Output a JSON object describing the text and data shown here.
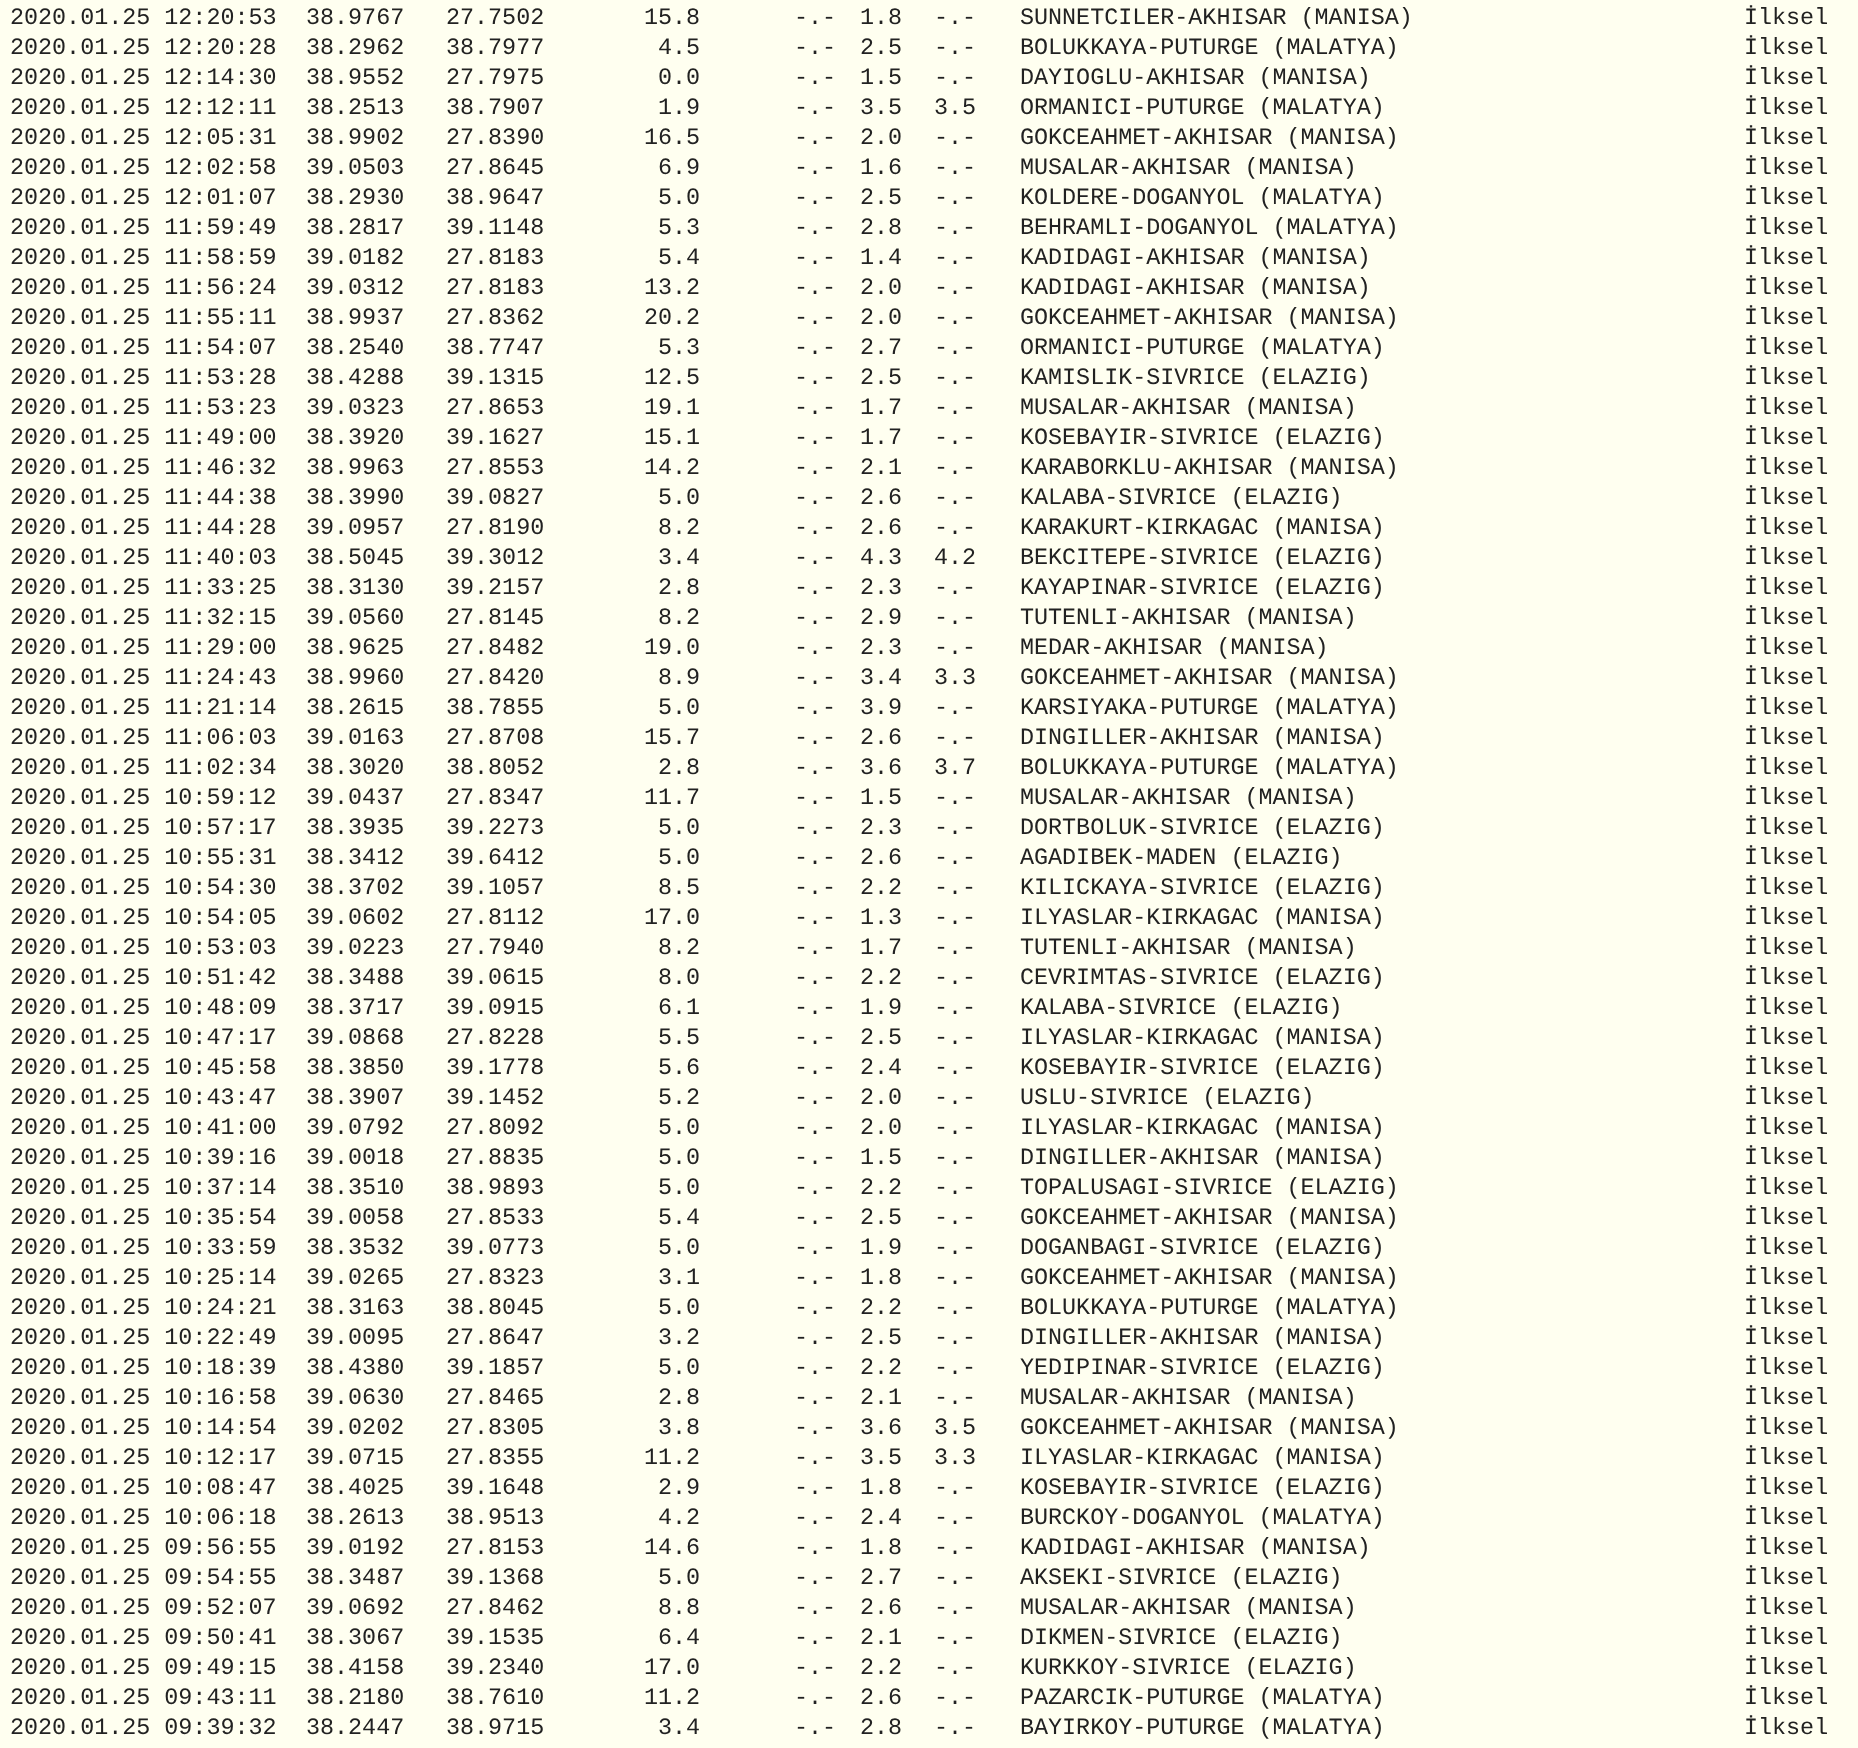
{
  "rows": [
    {
      "datetime": "2020.01.25 12:20:53",
      "latitude": "38.9767",
      "longitude": "27.7502",
      "depth": "15.8",
      "md": "-.-",
      "ml": "1.8",
      "mw": "-.-",
      "location": "SUNNETCILER-AKHISAR (MANISA)",
      "quality": "İlksel"
    },
    {
      "datetime": "2020.01.25 12:20:28",
      "latitude": "38.2962",
      "longitude": "38.7977",
      "depth": "4.5",
      "md": "-.-",
      "ml": "2.5",
      "mw": "-.-",
      "location": "BOLUKKAYA-PUTURGE (MALATYA)",
      "quality": "İlksel"
    },
    {
      "datetime": "2020.01.25 12:14:30",
      "latitude": "38.9552",
      "longitude": "27.7975",
      "depth": "0.0",
      "md": "-.-",
      "ml": "1.5",
      "mw": "-.-",
      "location": "DAYIOGLU-AKHISAR (MANISA)",
      "quality": "İlksel"
    },
    {
      "datetime": "2020.01.25 12:12:11",
      "latitude": "38.2513",
      "longitude": "38.7907",
      "depth": "1.9",
      "md": "-.-",
      "ml": "3.5",
      "mw": "3.5",
      "location": "ORMANICI-PUTURGE (MALATYA)",
      "quality": "İlksel"
    },
    {
      "datetime": "2020.01.25 12:05:31",
      "latitude": "38.9902",
      "longitude": "27.8390",
      "depth": "16.5",
      "md": "-.-",
      "ml": "2.0",
      "mw": "-.-",
      "location": "GOKCEAHMET-AKHISAR (MANISA)",
      "quality": "İlksel"
    },
    {
      "datetime": "2020.01.25 12:02:58",
      "latitude": "39.0503",
      "longitude": "27.8645",
      "depth": "6.9",
      "md": "-.-",
      "ml": "1.6",
      "mw": "-.-",
      "location": "MUSALAR-AKHISAR (MANISA)",
      "quality": "İlksel"
    },
    {
      "datetime": "2020.01.25 12:01:07",
      "latitude": "38.2930",
      "longitude": "38.9647",
      "depth": "5.0",
      "md": "-.-",
      "ml": "2.5",
      "mw": "-.-",
      "location": "KOLDERE-DOGANYOL (MALATYA)",
      "quality": "İlksel"
    },
    {
      "datetime": "2020.01.25 11:59:49",
      "latitude": "38.2817",
      "longitude": "39.1148",
      "depth": "5.3",
      "md": "-.-",
      "ml": "2.8",
      "mw": "-.-",
      "location": "BEHRAMLI-DOGANYOL (MALATYA)",
      "quality": "İlksel"
    },
    {
      "datetime": "2020.01.25 11:58:59",
      "latitude": "39.0182",
      "longitude": "27.8183",
      "depth": "5.4",
      "md": "-.-",
      "ml": "1.4",
      "mw": "-.-",
      "location": "KADIDAGI-AKHISAR (MANISA)",
      "quality": "İlksel"
    },
    {
      "datetime": "2020.01.25 11:56:24",
      "latitude": "39.0312",
      "longitude": "27.8183",
      "depth": "13.2",
      "md": "-.-",
      "ml": "2.0",
      "mw": "-.-",
      "location": "KADIDAGI-AKHISAR (MANISA)",
      "quality": "İlksel"
    },
    {
      "datetime": "2020.01.25 11:55:11",
      "latitude": "38.9937",
      "longitude": "27.8362",
      "depth": "20.2",
      "md": "-.-",
      "ml": "2.0",
      "mw": "-.-",
      "location": "GOKCEAHMET-AKHISAR (MANISA)",
      "quality": "İlksel"
    },
    {
      "datetime": "2020.01.25 11:54:07",
      "latitude": "38.2540",
      "longitude": "38.7747",
      "depth": "5.3",
      "md": "-.-",
      "ml": "2.7",
      "mw": "-.-",
      "location": "ORMANICI-PUTURGE (MALATYA)",
      "quality": "İlksel"
    },
    {
      "datetime": "2020.01.25 11:53:28",
      "latitude": "38.4288",
      "longitude": "39.1315",
      "depth": "12.5",
      "md": "-.-",
      "ml": "2.5",
      "mw": "-.-",
      "location": "KAMISLIK-SIVRICE (ELAZIG)",
      "quality": "İlksel"
    },
    {
      "datetime": "2020.01.25 11:53:23",
      "latitude": "39.0323",
      "longitude": "27.8653",
      "depth": "19.1",
      "md": "-.-",
      "ml": "1.7",
      "mw": "-.-",
      "location": "MUSALAR-AKHISAR (MANISA)",
      "quality": "İlksel"
    },
    {
      "datetime": "2020.01.25 11:49:00",
      "latitude": "38.3920",
      "longitude": "39.1627",
      "depth": "15.1",
      "md": "-.-",
      "ml": "1.7",
      "mw": "-.-",
      "location": "KOSEBAYIR-SIVRICE (ELAZIG)",
      "quality": "İlksel"
    },
    {
      "datetime": "2020.01.25 11:46:32",
      "latitude": "38.9963",
      "longitude": "27.8553",
      "depth": "14.2",
      "md": "-.-",
      "ml": "2.1",
      "mw": "-.-",
      "location": "KARABORKLU-AKHISAR (MANISA)",
      "quality": "İlksel"
    },
    {
      "datetime": "2020.01.25 11:44:38",
      "latitude": "38.3990",
      "longitude": "39.0827",
      "depth": "5.0",
      "md": "-.-",
      "ml": "2.6",
      "mw": "-.-",
      "location": "KALABA-SIVRICE (ELAZIG)",
      "quality": "İlksel"
    },
    {
      "datetime": "2020.01.25 11:44:28",
      "latitude": "39.0957",
      "longitude": "27.8190",
      "depth": "8.2",
      "md": "-.-",
      "ml": "2.6",
      "mw": "-.-",
      "location": "KARAKURT-KIRKAGAC (MANISA)",
      "quality": "İlksel"
    },
    {
      "datetime": "2020.01.25 11:40:03",
      "latitude": "38.5045",
      "longitude": "39.3012",
      "depth": "3.4",
      "md": "-.-",
      "ml": "4.3",
      "mw": "4.2",
      "location": "BEKCITEPE-SIVRICE (ELAZIG)",
      "quality": "İlksel"
    },
    {
      "datetime": "2020.01.25 11:33:25",
      "latitude": "38.3130",
      "longitude": "39.2157",
      "depth": "2.8",
      "md": "-.-",
      "ml": "2.3",
      "mw": "-.-",
      "location": "KAYAPINAR-SIVRICE (ELAZIG)",
      "quality": "İlksel"
    },
    {
      "datetime": "2020.01.25 11:32:15",
      "latitude": "39.0560",
      "longitude": "27.8145",
      "depth": "8.2",
      "md": "-.-",
      "ml": "2.9",
      "mw": "-.-",
      "location": "TUTENLI-AKHISAR (MANISA)",
      "quality": "İlksel"
    },
    {
      "datetime": "2020.01.25 11:29:00",
      "latitude": "38.9625",
      "longitude": "27.8482",
      "depth": "19.0",
      "md": "-.-",
      "ml": "2.3",
      "mw": "-.-",
      "location": "MEDAR-AKHISAR (MANISA)",
      "quality": "İlksel"
    },
    {
      "datetime": "2020.01.25 11:24:43",
      "latitude": "38.9960",
      "longitude": "27.8420",
      "depth": "8.9",
      "md": "-.-",
      "ml": "3.4",
      "mw": "3.3",
      "location": "GOKCEAHMET-AKHISAR (MANISA)",
      "quality": "İlksel"
    },
    {
      "datetime": "2020.01.25 11:21:14",
      "latitude": "38.2615",
      "longitude": "38.7855",
      "depth": "5.0",
      "md": "-.-",
      "ml": "3.9",
      "mw": "-.-",
      "location": "KARSIYAKA-PUTURGE (MALATYA)",
      "quality": "İlksel"
    },
    {
      "datetime": "2020.01.25 11:06:03",
      "latitude": "39.0163",
      "longitude": "27.8708",
      "depth": "15.7",
      "md": "-.-",
      "ml": "2.6",
      "mw": "-.-",
      "location": "DINGILLER-AKHISAR (MANISA)",
      "quality": "İlksel"
    },
    {
      "datetime": "2020.01.25 11:02:34",
      "latitude": "38.3020",
      "longitude": "38.8052",
      "depth": "2.8",
      "md": "-.-",
      "ml": "3.6",
      "mw": "3.7",
      "location": "BOLUKKAYA-PUTURGE (MALATYA)",
      "quality": "İlksel"
    },
    {
      "datetime": "2020.01.25 10:59:12",
      "latitude": "39.0437",
      "longitude": "27.8347",
      "depth": "11.7",
      "md": "-.-",
      "ml": "1.5",
      "mw": "-.-",
      "location": "MUSALAR-AKHISAR (MANISA)",
      "quality": "İlksel"
    },
    {
      "datetime": "2020.01.25 10:57:17",
      "latitude": "38.3935",
      "longitude": "39.2273",
      "depth": "5.0",
      "md": "-.-",
      "ml": "2.3",
      "mw": "-.-",
      "location": "DORTBOLUK-SIVRICE (ELAZIG)",
      "quality": "İlksel"
    },
    {
      "datetime": "2020.01.25 10:55:31",
      "latitude": "38.3412",
      "longitude": "39.6412",
      "depth": "5.0",
      "md": "-.-",
      "ml": "2.6",
      "mw": "-.-",
      "location": "AGADIBEK-MADEN (ELAZIG)",
      "quality": "İlksel"
    },
    {
      "datetime": "2020.01.25 10:54:30",
      "latitude": "38.3702",
      "longitude": "39.1057",
      "depth": "8.5",
      "md": "-.-",
      "ml": "2.2",
      "mw": "-.-",
      "location": "KILICKAYA-SIVRICE (ELAZIG)",
      "quality": "İlksel"
    },
    {
      "datetime": "2020.01.25 10:54:05",
      "latitude": "39.0602",
      "longitude": "27.8112",
      "depth": "17.0",
      "md": "-.-",
      "ml": "1.3",
      "mw": "-.-",
      "location": "ILYASLAR-KIRKAGAC (MANISA)",
      "quality": "İlksel"
    },
    {
      "datetime": "2020.01.25 10:53:03",
      "latitude": "39.0223",
      "longitude": "27.7940",
      "depth": "8.2",
      "md": "-.-",
      "ml": "1.7",
      "mw": "-.-",
      "location": "TUTENLI-AKHISAR (MANISA)",
      "quality": "İlksel"
    },
    {
      "datetime": "2020.01.25 10:51:42",
      "latitude": "38.3488",
      "longitude": "39.0615",
      "depth": "8.0",
      "md": "-.-",
      "ml": "2.2",
      "mw": "-.-",
      "location": "CEVRIMTAS-SIVRICE (ELAZIG)",
      "quality": "İlksel"
    },
    {
      "datetime": "2020.01.25 10:48:09",
      "latitude": "38.3717",
      "longitude": "39.0915",
      "depth": "6.1",
      "md": "-.-",
      "ml": "1.9",
      "mw": "-.-",
      "location": "KALABA-SIVRICE (ELAZIG)",
      "quality": "İlksel"
    },
    {
      "datetime": "2020.01.25 10:47:17",
      "latitude": "39.0868",
      "longitude": "27.8228",
      "depth": "5.5",
      "md": "-.-",
      "ml": "2.5",
      "mw": "-.-",
      "location": "ILYASLAR-KIRKAGAC (MANISA)",
      "quality": "İlksel"
    },
    {
      "datetime": "2020.01.25 10:45:58",
      "latitude": "38.3850",
      "longitude": "39.1778",
      "depth": "5.6",
      "md": "-.-",
      "ml": "2.4",
      "mw": "-.-",
      "location": "KOSEBAYIR-SIVRICE (ELAZIG)",
      "quality": "İlksel"
    },
    {
      "datetime": "2020.01.25 10:43:47",
      "latitude": "38.3907",
      "longitude": "39.1452",
      "depth": "5.2",
      "md": "-.-",
      "ml": "2.0",
      "mw": "-.-",
      "location": "USLU-SIVRICE (ELAZIG)",
      "quality": "İlksel"
    },
    {
      "datetime": "2020.01.25 10:41:00",
      "latitude": "39.0792",
      "longitude": "27.8092",
      "depth": "5.0",
      "md": "-.-",
      "ml": "2.0",
      "mw": "-.-",
      "location": "ILYASLAR-KIRKAGAC (MANISA)",
      "quality": "İlksel"
    },
    {
      "datetime": "2020.01.25 10:39:16",
      "latitude": "39.0018",
      "longitude": "27.8835",
      "depth": "5.0",
      "md": "-.-",
      "ml": "1.5",
      "mw": "-.-",
      "location": "DINGILLER-AKHISAR (MANISA)",
      "quality": "İlksel"
    },
    {
      "datetime": "2020.01.25 10:37:14",
      "latitude": "38.3510",
      "longitude": "38.9893",
      "depth": "5.0",
      "md": "-.-",
      "ml": "2.2",
      "mw": "-.-",
      "location": "TOPALUSAGI-SIVRICE (ELAZIG)",
      "quality": "İlksel"
    },
    {
      "datetime": "2020.01.25 10:35:54",
      "latitude": "39.0058",
      "longitude": "27.8533",
      "depth": "5.4",
      "md": "-.-",
      "ml": "2.5",
      "mw": "-.-",
      "location": "GOKCEAHMET-AKHISAR (MANISA)",
      "quality": "İlksel"
    },
    {
      "datetime": "2020.01.25 10:33:59",
      "latitude": "38.3532",
      "longitude": "39.0773",
      "depth": "5.0",
      "md": "-.-",
      "ml": "1.9",
      "mw": "-.-",
      "location": "DOGANBAGI-SIVRICE (ELAZIG)",
      "quality": "İlksel"
    },
    {
      "datetime": "2020.01.25 10:25:14",
      "latitude": "39.0265",
      "longitude": "27.8323",
      "depth": "3.1",
      "md": "-.-",
      "ml": "1.8",
      "mw": "-.-",
      "location": "GOKCEAHMET-AKHISAR (MANISA)",
      "quality": "İlksel"
    },
    {
      "datetime": "2020.01.25 10:24:21",
      "latitude": "38.3163",
      "longitude": "38.8045",
      "depth": "5.0",
      "md": "-.-",
      "ml": "2.2",
      "mw": "-.-",
      "location": "BOLUKKAYA-PUTURGE (MALATYA)",
      "quality": "İlksel"
    },
    {
      "datetime": "2020.01.25 10:22:49",
      "latitude": "39.0095",
      "longitude": "27.8647",
      "depth": "3.2",
      "md": "-.-",
      "ml": "2.5",
      "mw": "-.-",
      "location": "DINGILLER-AKHISAR (MANISA)",
      "quality": "İlksel"
    },
    {
      "datetime": "2020.01.25 10:18:39",
      "latitude": "38.4380",
      "longitude": "39.1857",
      "depth": "5.0",
      "md": "-.-",
      "ml": "2.2",
      "mw": "-.-",
      "location": "YEDIPINAR-SIVRICE (ELAZIG)",
      "quality": "İlksel"
    },
    {
      "datetime": "2020.01.25 10:16:58",
      "latitude": "39.0630",
      "longitude": "27.8465",
      "depth": "2.8",
      "md": "-.-",
      "ml": "2.1",
      "mw": "-.-",
      "location": "MUSALAR-AKHISAR (MANISA)",
      "quality": "İlksel"
    },
    {
      "datetime": "2020.01.25 10:14:54",
      "latitude": "39.0202",
      "longitude": "27.8305",
      "depth": "3.8",
      "md": "-.-",
      "ml": "3.6",
      "mw": "3.5",
      "location": "GOKCEAHMET-AKHISAR (MANISA)",
      "quality": "İlksel"
    },
    {
      "datetime": "2020.01.25 10:12:17",
      "latitude": "39.0715",
      "longitude": "27.8355",
      "depth": "11.2",
      "md": "-.-",
      "ml": "3.5",
      "mw": "3.3",
      "location": "ILYASLAR-KIRKAGAC (MANISA)",
      "quality": "İlksel"
    },
    {
      "datetime": "2020.01.25 10:08:47",
      "latitude": "38.4025",
      "longitude": "39.1648",
      "depth": "2.9",
      "md": "-.-",
      "ml": "1.8",
      "mw": "-.-",
      "location": "KOSEBAYIR-SIVRICE (ELAZIG)",
      "quality": "İlksel"
    },
    {
      "datetime": "2020.01.25 10:06:18",
      "latitude": "38.2613",
      "longitude": "38.9513",
      "depth": "4.2",
      "md": "-.-",
      "ml": "2.4",
      "mw": "-.-",
      "location": "BURCKOY-DOGANYOL (MALATYA)",
      "quality": "İlksel"
    },
    {
      "datetime": "2020.01.25 09:56:55",
      "latitude": "39.0192",
      "longitude": "27.8153",
      "depth": "14.6",
      "md": "-.-",
      "ml": "1.8",
      "mw": "-.-",
      "location": "KADIDAGI-AKHISAR (MANISA)",
      "quality": "İlksel"
    },
    {
      "datetime": "2020.01.25 09:54:55",
      "latitude": "38.3487",
      "longitude": "39.1368",
      "depth": "5.0",
      "md": "-.-",
      "ml": "2.7",
      "mw": "-.-",
      "location": "AKSEKI-SIVRICE (ELAZIG)",
      "quality": "İlksel"
    },
    {
      "datetime": "2020.01.25 09:52:07",
      "latitude": "39.0692",
      "longitude": "27.8462",
      "depth": "8.8",
      "md": "-.-",
      "ml": "2.6",
      "mw": "-.-",
      "location": "MUSALAR-AKHISAR (MANISA)",
      "quality": "İlksel"
    },
    {
      "datetime": "2020.01.25 09:50:41",
      "latitude": "38.3067",
      "longitude": "39.1535",
      "depth": "6.4",
      "md": "-.-",
      "ml": "2.1",
      "mw": "-.-",
      "location": "DIKMEN-SIVRICE (ELAZIG)",
      "quality": "İlksel"
    },
    {
      "datetime": "2020.01.25 09:49:15",
      "latitude": "38.4158",
      "longitude": "39.2340",
      "depth": "17.0",
      "md": "-.-",
      "ml": "2.2",
      "mw": "-.-",
      "location": "KURKKOY-SIVRICE (ELAZIG)",
      "quality": "İlksel"
    },
    {
      "datetime": "2020.01.25 09:43:11",
      "latitude": "38.2180",
      "longitude": "38.7610",
      "depth": "11.2",
      "md": "-.-",
      "ml": "2.6",
      "mw": "-.-",
      "location": "PAZARCIK-PUTURGE (MALATYA)",
      "quality": "İlksel"
    },
    {
      "datetime": "2020.01.25 09:39:32",
      "latitude": "38.2447",
      "longitude": "38.9715",
      "depth": "3.4",
      "md": "-.-",
      "ml": "2.8",
      "mw": "-.-",
      "location": "BAYIRKOY-PUTURGE (MALATYA)",
      "quality": "İlksel"
    }
  ]
}
